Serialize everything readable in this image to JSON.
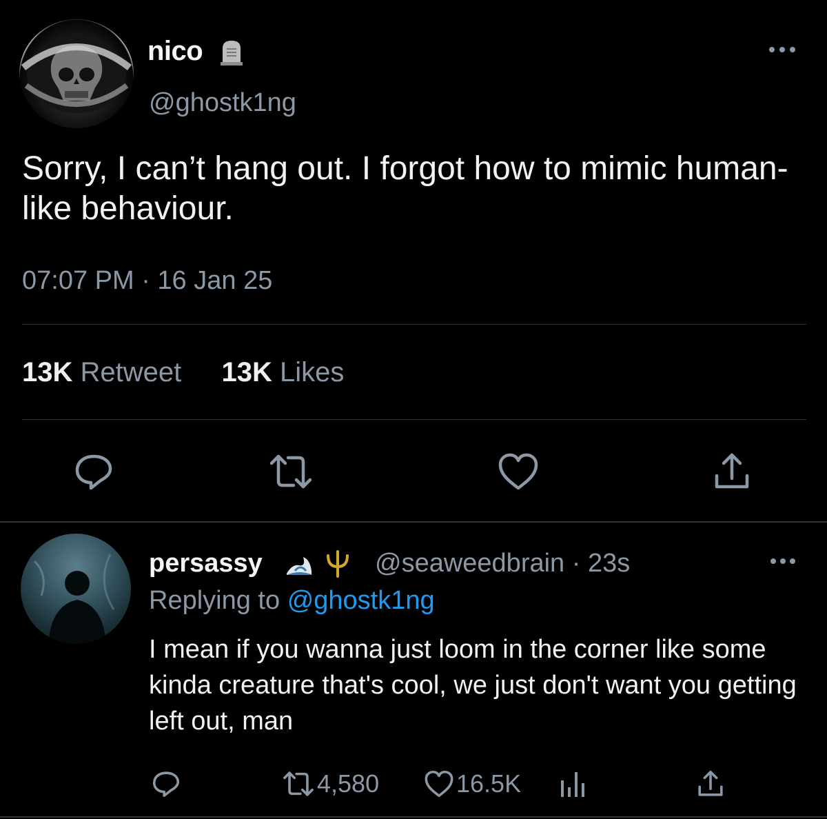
{
  "tweet": {
    "author": {
      "display_name": "nico",
      "handle": "@ghostk1ng",
      "badge_icon": "tombstone-icon"
    },
    "text": "Sorry, I can’t hang out. I forgot how to mimic human-like behaviour.",
    "timestamp": "07:07 PM · 16 Jan 25",
    "stats": {
      "retweets_count": "13K",
      "retweets_label": "Retweet",
      "likes_count": "13K",
      "likes_label": "Likes"
    },
    "actions": [
      "reply-icon",
      "retweet-icon",
      "like-icon",
      "share-icon"
    ]
  },
  "reply": {
    "author": {
      "display_name": "persassy",
      "emoji": "🌊🔱",
      "handle_time": "@seaweedbrain · 23s"
    },
    "replying_prefix": "Replying to",
    "replying_to": "@ghostk1ng",
    "text": "I mean if you wanna just loom in the corner like some kinda creature that's cool, we just don't want you getting left out, man",
    "retweets": "4,580",
    "likes": "16.5K"
  },
  "colors": {
    "background": "#000000",
    "text": "#e7e9ea",
    "secondary": "#8b98a5",
    "link": "#1d9bf0",
    "divider": "#2f3336"
  }
}
